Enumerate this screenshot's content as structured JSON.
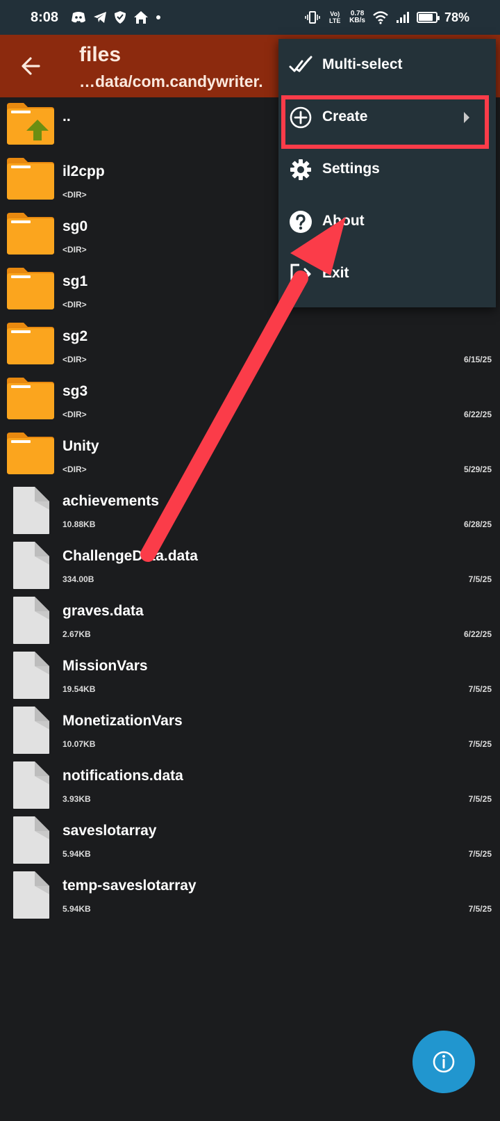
{
  "status_bar": {
    "time": "8:08",
    "net_speed_value": "0.78",
    "net_speed_unit": "KB/s",
    "volte": "Vo) LTE",
    "battery_percent": "78%",
    "battery_level": 0.78,
    "icons": [
      "discord-icon",
      "telegram-icon",
      "shield-icon",
      "home-icon",
      "dot-icon",
      "vibrate-icon",
      "wifi-icon",
      "signal-icon",
      "battery-icon"
    ]
  },
  "toolbar": {
    "title": "files",
    "path": "…data/com.candywriter.",
    "back_icon": "arrow-left-icon",
    "color": "#8c2a0e"
  },
  "files": [
    {
      "name": "..",
      "meta": "",
      "date": "",
      "type": "parent"
    },
    {
      "name": "il2cpp",
      "meta": "<DIR>",
      "date": "",
      "type": "folder"
    },
    {
      "name": "sg0",
      "meta": "<DIR>",
      "date": "",
      "type": "folder"
    },
    {
      "name": "sg1",
      "meta": "<DIR>",
      "date": "",
      "type": "folder"
    },
    {
      "name": "sg2",
      "meta": "<DIR>",
      "date": "6/15/25",
      "type": "folder"
    },
    {
      "name": "sg3",
      "meta": "<DIR>",
      "date": "6/22/25",
      "type": "folder"
    },
    {
      "name": "Unity",
      "meta": "<DIR>",
      "date": "5/29/25",
      "type": "folder"
    },
    {
      "name": "achievements",
      "meta": "10.88KB",
      "date": "6/28/25",
      "type": "file"
    },
    {
      "name": "ChallengeData.data",
      "meta": "334.00B",
      "date": "7/5/25",
      "type": "file"
    },
    {
      "name": "graves.data",
      "meta": "2.67KB",
      "date": "6/22/25",
      "type": "file"
    },
    {
      "name": "MissionVars",
      "meta": "19.54KB",
      "date": "7/5/25",
      "type": "file"
    },
    {
      "name": "MonetizationVars",
      "meta": "10.07KB",
      "date": "7/5/25",
      "type": "file"
    },
    {
      "name": "notifications.data",
      "meta": "3.93KB",
      "date": "7/5/25",
      "type": "file"
    },
    {
      "name": "saveslotarray",
      "meta": "5.94KB",
      "date": "7/5/25",
      "type": "file"
    },
    {
      "name": "temp-saveslotarray",
      "meta": "5.94KB",
      "date": "7/5/25",
      "type": "file"
    }
  ],
  "menu": {
    "items": [
      {
        "label": "Multi-select",
        "icon": "double-check-icon"
      },
      {
        "label": "Create",
        "icon": "plus-circle-icon",
        "has_submenu": true
      },
      {
        "label": "Settings",
        "icon": "gear-icon"
      },
      {
        "label": "About",
        "icon": "help-circle-icon"
      },
      {
        "label": "Exit",
        "icon": "exit-icon"
      }
    ]
  },
  "annotation": {
    "highlight_color": "#fb3c49",
    "highlighted_item": "Create"
  },
  "fab": {
    "icon": "info-icon",
    "color": "#2196cf"
  },
  "colors": {
    "background": "#1b1c1e",
    "folder": "#fba51e",
    "menu_bg": "#243239"
  }
}
